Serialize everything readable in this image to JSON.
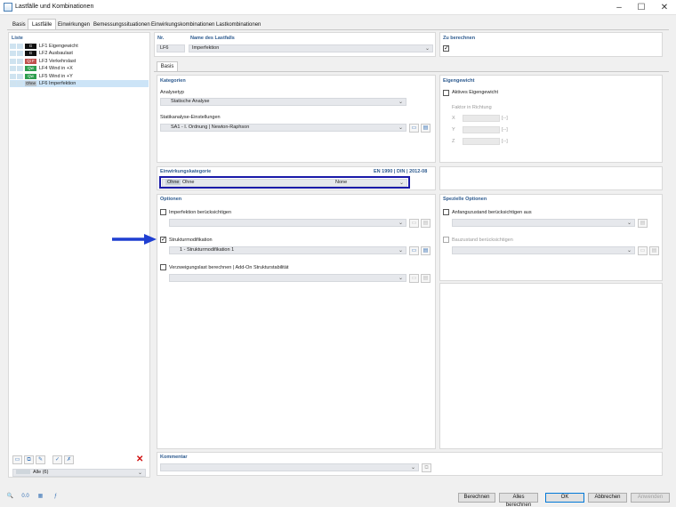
{
  "window": {
    "title": "Lastfälle und Kombinationen",
    "minimize": "–",
    "maximize": "☐",
    "close": "✕"
  },
  "tabs": [
    "Basis",
    "Lastfälle",
    "Einwirkungen",
    "Bemessungssituationen",
    "Einwirkungskombinationen",
    "Lastkombinationen"
  ],
  "active_tab": "Lastfälle",
  "list": {
    "title": "Liste",
    "items": [
      {
        "badge": "G",
        "badge_color": "#111111",
        "label": "LF1 Eigengewicht"
      },
      {
        "badge": "G",
        "badge_color": "#111111",
        "label": "LF2 Ausbaulast"
      },
      {
        "badge": "Qi F",
        "badge_color": "#c0504d",
        "label": "LF3 Verkehrslast"
      },
      {
        "badge": "Qw",
        "badge_color": "#2e9e4e",
        "label": "LF4 Wind in +X"
      },
      {
        "badge": "Qw",
        "badge_color": "#2e9e4e",
        "label": "LF5 Wind in +Y"
      },
      {
        "badge": "Ohne",
        "badge_color": "#b9c4cc",
        "label": "LF6 Imperfektion"
      }
    ],
    "selected_index": 5,
    "filter_value": "Alle (6)"
  },
  "header": {
    "nr_label": "Nr.",
    "nr_value": "LF6",
    "name_label": "Name des Lastfalls",
    "name_value": "Imperfektion",
    "calc_label": "Zu berechnen"
  },
  "subtab": "Basis",
  "kategorien": {
    "title": "Kategorien",
    "analysetyp_label": "Analysetyp",
    "analysetyp_value": "Statische Analyse",
    "statik_label": "Statikanalyse-Einstellungen",
    "statik_value": "SA1 - I. Ordnung | Newton-Raphson"
  },
  "eigengewicht": {
    "title": "Eigengewicht",
    "aktiv_label": "Aktives Eigengewicht",
    "faktor_label": "Faktor in Richtung",
    "axes": [
      "X",
      "Y",
      "Z"
    ],
    "unit": "[--]"
  },
  "einwirkung": {
    "title": "Einwirkungskategorie",
    "norm": "EN 1990 | DIN | 2012-08",
    "badge": "Ohne",
    "value": "Ohne",
    "value_right": "None"
  },
  "optionen": {
    "title": "Optionen",
    "imperfektion": "Imperfektion berücksichtigen",
    "strukturmod": "Strukturmodifikation",
    "strukturmod_value": "1 - Strukturmodifikation 1",
    "verzweigung": "Verzweigungslast berechnen | Add-On Strukturstabilität"
  },
  "spezielle": {
    "title": "Spezielle Optionen",
    "anfang": "Anfangszustand berücksichtigen aus",
    "bauzustand": "Bauzustand berücksichtigen"
  },
  "kommentar": {
    "title": "Kommentar"
  },
  "buttons": {
    "berechnen": "Berechnen",
    "alles": "Alles berechnen",
    "ok": "OK",
    "abbrechen": "Abbrechen",
    "anwenden": "Anwenden"
  },
  "colors": {
    "accent": "#2e5b8f",
    "arrow": "#1f3fd1",
    "highlight_border": "#1a1aa8",
    "selection": "#cce4f7"
  }
}
